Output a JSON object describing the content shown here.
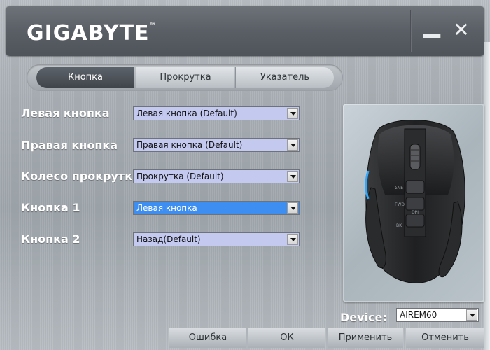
{
  "header": {
    "brand": "GIGABYTE",
    "trademark": "™",
    "minimize_icon": "minimize-icon",
    "close_icon": "close-icon",
    "close_glyph": "✕"
  },
  "tabs": [
    {
      "label": "Кнопка",
      "active": true
    },
    {
      "label": "Прокрутка",
      "active": false
    },
    {
      "label": "Указатель",
      "active": false
    }
  ],
  "rows": [
    {
      "label": "Левая кнопка",
      "value": "Левая кнопка (Default)"
    },
    {
      "label": "Правая кнопка",
      "value": "Правая кнопка (Default)"
    },
    {
      "label": "Колесо прокрутки",
      "value": "Прокрутка (Default)"
    },
    {
      "label": "Кнопка 1",
      "value": "Левая кнопка",
      "highlighted": true
    },
    {
      "label": "Кнопка 2",
      "value": "Назад(Default)"
    }
  ],
  "mouse": {
    "image": "mouse-image",
    "labels": [
      "ΣNE",
      "FWD",
      "BK",
      "DPI"
    ]
  },
  "device": {
    "label": "Device:",
    "value": "AIREM60"
  },
  "buttons": {
    "error": "Ошибка",
    "ok": "ОК",
    "apply": "Применить",
    "cancel": "Отменить"
  },
  "colors": {
    "select_bg": "#c4c9f0",
    "select_highlight": "#3d8ef0",
    "accent_blue": "#2fa8ff"
  }
}
